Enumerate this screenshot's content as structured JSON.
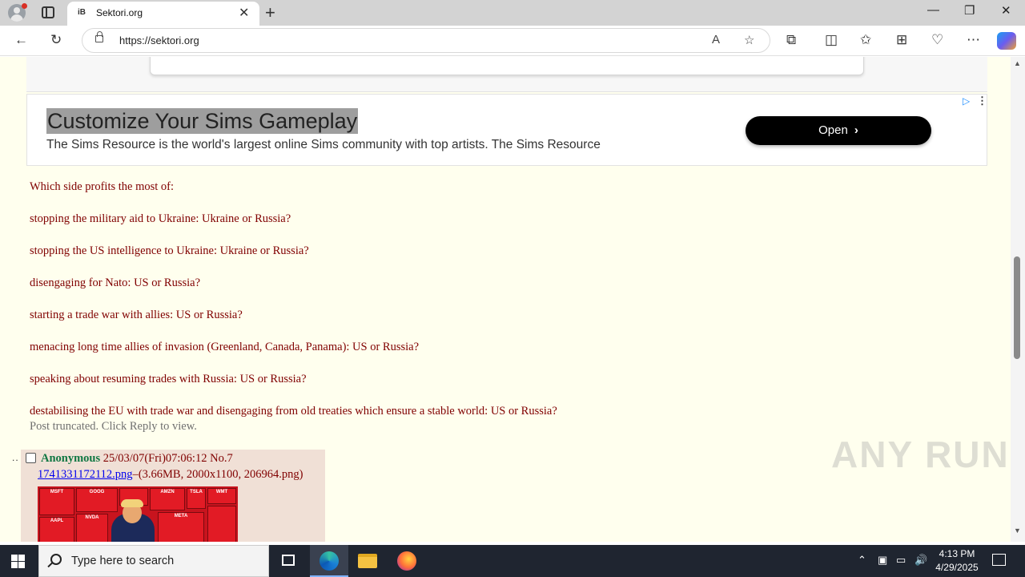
{
  "browser": {
    "tab_favicon": "iB",
    "tab_title": "Sektori.org",
    "tab_close": "✕",
    "new_tab": "+",
    "url": "https://sektori.org",
    "window_controls": {
      "minimize": "—",
      "restore": "❐",
      "close": "✕"
    },
    "toolbar_icons": [
      "back-icon",
      "refresh-icon",
      "read-aloud-icon",
      "favorite-icon",
      "extensions-icon",
      "split-screen-icon",
      "favorites-icon",
      "collections-icon",
      "browser-essentials-icon",
      "more-icon",
      "copilot-icon"
    ]
  },
  "ad": {
    "title": "Customize Your Sims Gameplay",
    "description": "The Sims Resource is the world's largest online Sims community with top artists. The Sims Resource",
    "button_label": "Open",
    "button_chevron": "›"
  },
  "post": {
    "lines": [
      "Which side profits the most of:",
      "stopping the military aid to Ukraine: Ukraine or Russia?",
      "stopping the US intelligence to Ukraine: Ukraine or Russia?",
      "disengaging for Nato: US or Russia?",
      "starting a trade war with allies: US or Russia?",
      "menacing long time allies of invasion (Greenland, Canada, Panama): US or Russia?",
      "speaking about resuming trades with Russia: US or Russia?",
      "destabilising the EU with trade war and disengaging from old treaties which ensure a stable world: US or Russia?"
    ],
    "truncated_notice": "Post truncated. Click Reply to view."
  },
  "reply": {
    "dots": "..",
    "name": "Anonymous",
    "datetime": "25/03/07(Fri)07:06:12",
    "post_no": "No.7",
    "file_name": "1741331172112.png",
    "file_info": "–(3.66MB, 2000x1100, 206964.png)",
    "thumb_labels": [
      "MSFT",
      "GOOG",
      "AMZN",
      "AAPL",
      "NVDA",
      "META",
      "TSLA",
      "WMT"
    ]
  },
  "watermark": "ANY RUN",
  "taskbar": {
    "search_placeholder": "Type here to search",
    "time": "4:13 PM",
    "date": "4/29/2025",
    "tray_icons": [
      "chevron-up-icon",
      "meet-now-icon",
      "network-icon",
      "volume-icon"
    ]
  },
  "colors": {
    "page_bg": "#ffffee",
    "post_text": "#800000",
    "name_green": "#117743",
    "reply_bg": "#f0e0d6",
    "link": "#0000ee",
    "taskbar": "#1f2530"
  }
}
